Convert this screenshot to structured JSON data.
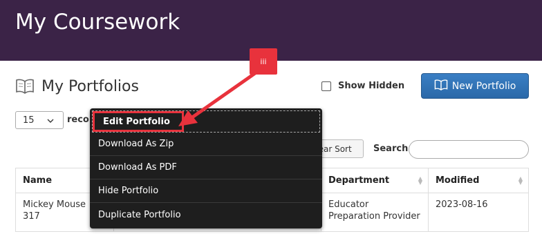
{
  "banner": {
    "title": "My Coursework"
  },
  "section": {
    "title": "My Portfolios"
  },
  "show_hidden": {
    "label": "Show Hidden"
  },
  "new_portfolio": {
    "label": "New Portfolio"
  },
  "page_size": {
    "value": "15"
  },
  "records_label": "reco",
  "clear_sort": {
    "label": "lear Sort"
  },
  "search": {
    "label": "Search:",
    "value": ""
  },
  "table": {
    "columns": [
      "Name",
      "Department",
      "Modified"
    ],
    "rows": [
      {
        "name": "Mickey Mouse",
        "name_suffix": "317",
        "department": "Educator Preparation Provider",
        "modified": "2023-08-16"
      }
    ]
  },
  "context_menu": {
    "items": [
      "Edit Portfolio",
      "Download As Zip",
      "Download As PDF",
      "Hide Portfolio",
      "Duplicate Portfolio"
    ]
  },
  "annotation": {
    "callout_label": "iii"
  },
  "colors": {
    "banner": "#3b2347",
    "primary_button": "#2a68a8",
    "annotation_red": "#e8323c",
    "menu_bg": "#1e1e1e"
  }
}
